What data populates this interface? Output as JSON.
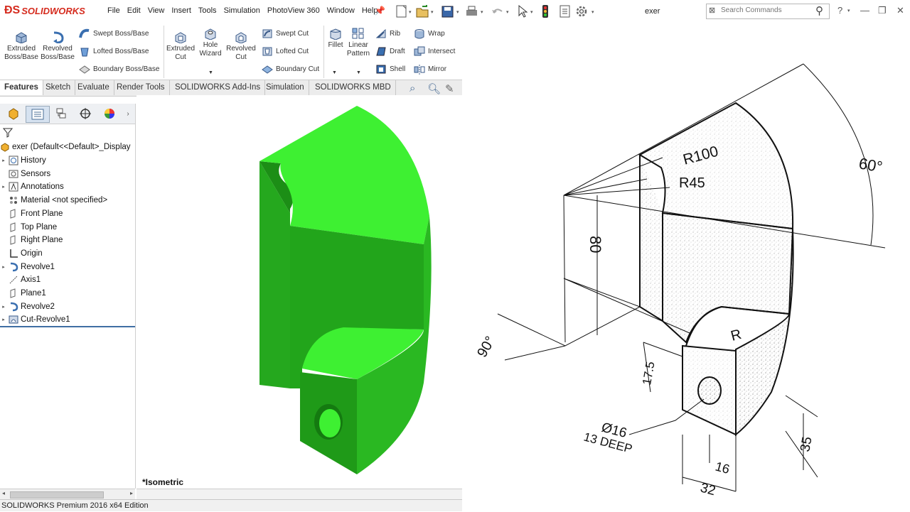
{
  "app": {
    "logo_text": "SOLIDWORKS",
    "doc_title": "exer",
    "brand_color": "#d52b1e"
  },
  "menu": {
    "items": [
      "File",
      "Edit",
      "View",
      "Insert",
      "Tools",
      "Simulation",
      "PhotoView 360",
      "Window",
      "Help"
    ]
  },
  "search": {
    "placeholder": "Search Commands"
  },
  "toolbar": {
    "extruded_boss": "Extruded\nBoss/Base",
    "revolved_boss": "Revolved\nBoss/Base",
    "swept_boss": "Swept Boss/Base",
    "lofted_boss": "Lofted Boss/Base",
    "boundary_boss": "Boundary Boss/Base",
    "extruded_cut": "Extruded\nCut",
    "hole_wizard": "Hole\nWizard",
    "revolved_cut": "Revolved\nCut",
    "swept_cut": "Swept Cut",
    "lofted_cut": "Lofted Cut",
    "boundary_cut": "Boundary Cut",
    "fillet": "Fillet",
    "linear_pattern": "Linear\nPattern",
    "rib": "Rib",
    "draft": "Draft",
    "shell": "Shell",
    "wrap": "Wrap",
    "intersect": "Intersect",
    "mirror": "Mirror"
  },
  "tabs": [
    "Features",
    "Sketch",
    "Evaluate",
    "Render Tools",
    "SOLIDWORKS Add-Ins",
    "Simulation",
    "SOLIDWORKS MBD"
  ],
  "active_tab": "Features",
  "feature_tree": {
    "root": "exer  (Default<<Default>_Display",
    "items": [
      {
        "label": "History",
        "icon": "history-icon",
        "expandable": true
      },
      {
        "label": "Sensors",
        "icon": "sensor-icon",
        "expandable": false
      },
      {
        "label": "Annotations",
        "icon": "annotation-icon",
        "expandable": true
      },
      {
        "label": "Material <not specified>",
        "icon": "material-icon",
        "expandable": false
      },
      {
        "label": "Front Plane",
        "icon": "plane-icon",
        "expandable": false
      },
      {
        "label": "Top Plane",
        "icon": "plane-icon",
        "expandable": false
      },
      {
        "label": "Right Plane",
        "icon": "plane-icon",
        "expandable": false
      },
      {
        "label": "Origin",
        "icon": "origin-icon",
        "expandable": false
      },
      {
        "label": "Revolve1",
        "icon": "revolve-icon",
        "expandable": true
      },
      {
        "label": "Axis1",
        "icon": "axis-icon",
        "expandable": false
      },
      {
        "label": "Plane1",
        "icon": "plane-icon",
        "expandable": false
      },
      {
        "label": "Revolve2",
        "icon": "revolve-icon",
        "expandable": true
      },
      {
        "label": "Cut-Revolve1",
        "icon": "cut-revolve-icon",
        "expandable": true
      }
    ]
  },
  "viewport": {
    "view_label": "*Isometric",
    "model_color": "#33e52b"
  },
  "status": {
    "text": "SOLIDWORKS Premium 2016 x64 Edition"
  },
  "reference_drawing": {
    "labels": {
      "r100": "R100",
      "r45": "R45",
      "angle60": "60°",
      "dim80": "80",
      "angle90": "90°",
      "r": "R",
      "dim175": "17.5",
      "hole": "Ø16",
      "deep": "13 DEEP",
      "dim35": "35",
      "dim16": "16",
      "dim32": "32"
    }
  }
}
